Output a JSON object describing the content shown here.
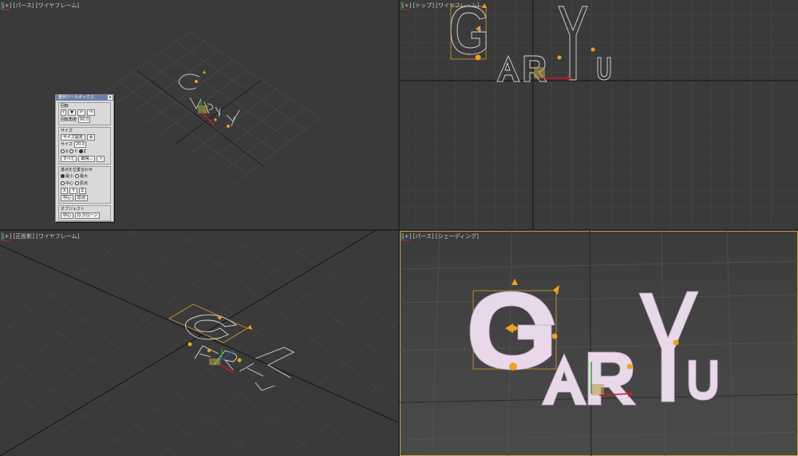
{
  "viewports": {
    "perspective_wire": {
      "label": "[+] [パース] [ワイヤフレーム]"
    },
    "top": {
      "label": "[+] [トップ] [ワイヤフレーム]"
    },
    "ortho": {
      "label": "[+] [正投影] [ワイヤフレーム]"
    },
    "perspective_shaded": {
      "label": "[+] [パース] [シェーディング]"
    }
  },
  "scene_text": {
    "letters": [
      "G",
      "A",
      "R",
      "Y",
      "u"
    ]
  },
  "toolbox": {
    "title": "整列ツールボックス",
    "close": "x",
    "rotate": {
      "label": "回転",
      "axis_value": "Y",
      "angle_label": "回転角度",
      "angle_value": "90.0"
    },
    "size": {
      "label": "サイズ",
      "set_button": "サイズ設定",
      "size_label": "サイズ",
      "size_value": "20.0",
      "axis_x": "X",
      "axis_y": "Y",
      "axis_z": "Z",
      "all_button": "すべて",
      "pick_button": "取得..."
    },
    "align": {
      "label": "基点を位置合わせ",
      "min": "最小",
      "max": "最大",
      "center": "中心",
      "pivot": "原点",
      "x": "X",
      "y": "Y",
      "z": "Z",
      "center_button": "中心",
      "pivot_button": "原点"
    },
    "object": {
      "label": "オブジェクト",
      "center_button": "中心",
      "clone_button": "Q.クローン"
    }
  },
  "colors": {
    "viewport_bg": "#3a3a3a",
    "grid": "#4a4a4a",
    "grid_axis": "#1a1a1a",
    "spline": "#d8d8d8",
    "selection": "#d99a2b",
    "gizmo_orange": "#f0a020",
    "shaded_letters": "#e8d8ea",
    "active_border": "#c8a33a"
  }
}
